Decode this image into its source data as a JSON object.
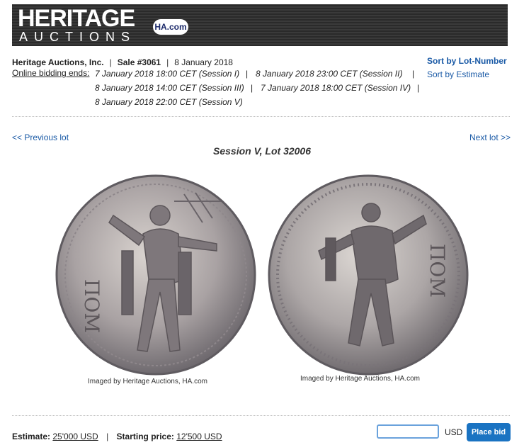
{
  "brand": {
    "logo_top": "HERITAGE",
    "logo_bottom": "AUCTIONS",
    "logo_badge": "HA.com"
  },
  "sale": {
    "house": "Heritage Auctions, Inc.",
    "sale_label": "Sale #3061",
    "sale_date": "8 January 2018",
    "ends_label": "Online bidding ends:",
    "sessions": [
      "7 January 2018 18:00 CET (Session I)",
      "8 January 2018 23:00 CET (Session II)",
      "8 January 2018 14:00 CET (Session III)",
      "7 January 2018 18:00 CET (Session IV)",
      "8 January 2018 22:00 CET (Session V)"
    ],
    "separator": "|"
  },
  "sort": {
    "by_lot": "Sort by Lot-Number",
    "by_estimate": "Sort by Estimate"
  },
  "nav": {
    "previous": "<< Previous lot",
    "next": "Next lot >>"
  },
  "lot": {
    "title": "Session V, Lot 32006",
    "obverse_credit": "Imaged by Heritage Auctions, HA.com",
    "reverse_credit": "Imaged by Heritage Auctions, HA.com",
    "obverse_legend": "ΠΟΜ",
    "reverse_legend": "ΠΟΜ"
  },
  "pricing": {
    "estimate_label": "Estimate:",
    "estimate_value": "25'000 USD",
    "starting_label": "Starting price:",
    "starting_value": "12'500 USD"
  },
  "bid": {
    "input_value": "",
    "currency": "USD",
    "button": "Place bid"
  },
  "colors": {
    "link": "#1a5aa6",
    "button": "#1a73c2",
    "banner": "#2a2a2a"
  }
}
